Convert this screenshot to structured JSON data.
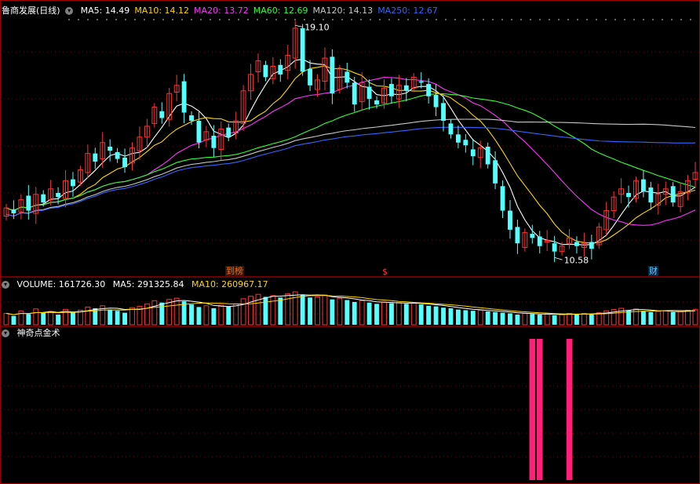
{
  "header": {
    "stock_name": "鲁商发展(日线)",
    "ma": [
      {
        "label": "MA5: 14.49",
        "color": "#ffffff"
      },
      {
        "label": "MA10: 14.12",
        "color": "#ffd700"
      },
      {
        "label": "MA20: 13.72",
        "color": "#ff33ff"
      },
      {
        "label": "MA60: 12.69",
        "color": "#33ff33"
      },
      {
        "label": "MA120: 14.13",
        "color": "#c8c8c8"
      },
      {
        "label": "MA250: 12.67",
        "color": "#3366ff"
      }
    ]
  },
  "volume_panel": {
    "title": "VOLUME: 161726.30",
    "ma5": "MA5: 291325.84",
    "ma10": "MA10: 260967.17"
  },
  "indicator_panel": {
    "title": "神奇点金术"
  },
  "markers": {
    "m1": "到榜",
    "m2": "$",
    "m3": "财"
  },
  "chart_data": {
    "type": "candlestick",
    "high_label": "19.10",
    "low_label": "10.58",
    "ylim": [
      10.3,
      19.4
    ],
    "closes": [
      12.4,
      12.2,
      12.7,
      12.3,
      12.9,
      12.6,
      13.1,
      12.8,
      13.4,
      13.2,
      13.8,
      14.4,
      14.1,
      14.8,
      14.5,
      14.2,
      13.9,
      14.6,
      15.0,
      15.4,
      16.1,
      15.7,
      16.6,
      16.9,
      15.9,
      15.6,
      14.8,
      15.2,
      14.6,
      15.3,
      15.0,
      15.6,
      16.7,
      17.3,
      17.8,
      17.2,
      17.6,
      17.3,
      18.0,
      19.0,
      17.4,
      16.9,
      17.1,
      17.9,
      16.6,
      17.5,
      17.0,
      16.2,
      17.0,
      16.4,
      16.2,
      16.8,
      16.5,
      16.9,
      16.7,
      17.2,
      17.0,
      16.5,
      16.1,
      15.6,
      15.1,
      14.8,
      14.7,
      14.3,
      14.6,
      14.0,
      13.3,
      12.3,
      11.6,
      11.1,
      11.5,
      11.3,
      11.0,
      11.2,
      10.8,
      11.0,
      11.3,
      11.0,
      11.1,
      10.9,
      11.7,
      12.3,
      12.8,
      13.1,
      12.8,
      13.4,
      13.0,
      12.6,
      12.9,
      13.1,
      12.6,
      13.0,
      13.4,
      13.7
    ]
  },
  "volume_data": [
    18,
    14,
    22,
    17,
    25,
    19,
    21,
    16,
    24,
    20,
    23,
    28,
    26,
    30,
    24,
    22,
    19,
    27,
    29,
    33,
    38,
    35,
    40,
    42,
    37,
    32,
    28,
    30,
    26,
    31,
    29,
    33,
    41,
    45,
    48,
    44,
    46,
    43,
    49,
    52,
    47,
    43,
    44,
    47,
    40,
    42,
    39,
    36,
    38,
    35,
    33,
    36,
    34,
    35,
    33,
    34,
    32,
    30,
    29,
    27,
    26,
    24,
    23,
    22,
    23,
    21,
    20,
    19,
    18,
    16,
    18,
    17,
    16,
    17,
    15,
    16,
    18,
    17,
    18,
    17,
    19,
    22,
    24,
    26,
    23,
    25,
    22,
    20,
    21,
    22,
    20,
    21,
    23,
    24
  ],
  "signals": [
    {
      "index": 71,
      "value": 1
    },
    {
      "index": 72,
      "value": 1
    },
    {
      "index": 76,
      "value": 1
    }
  ]
}
